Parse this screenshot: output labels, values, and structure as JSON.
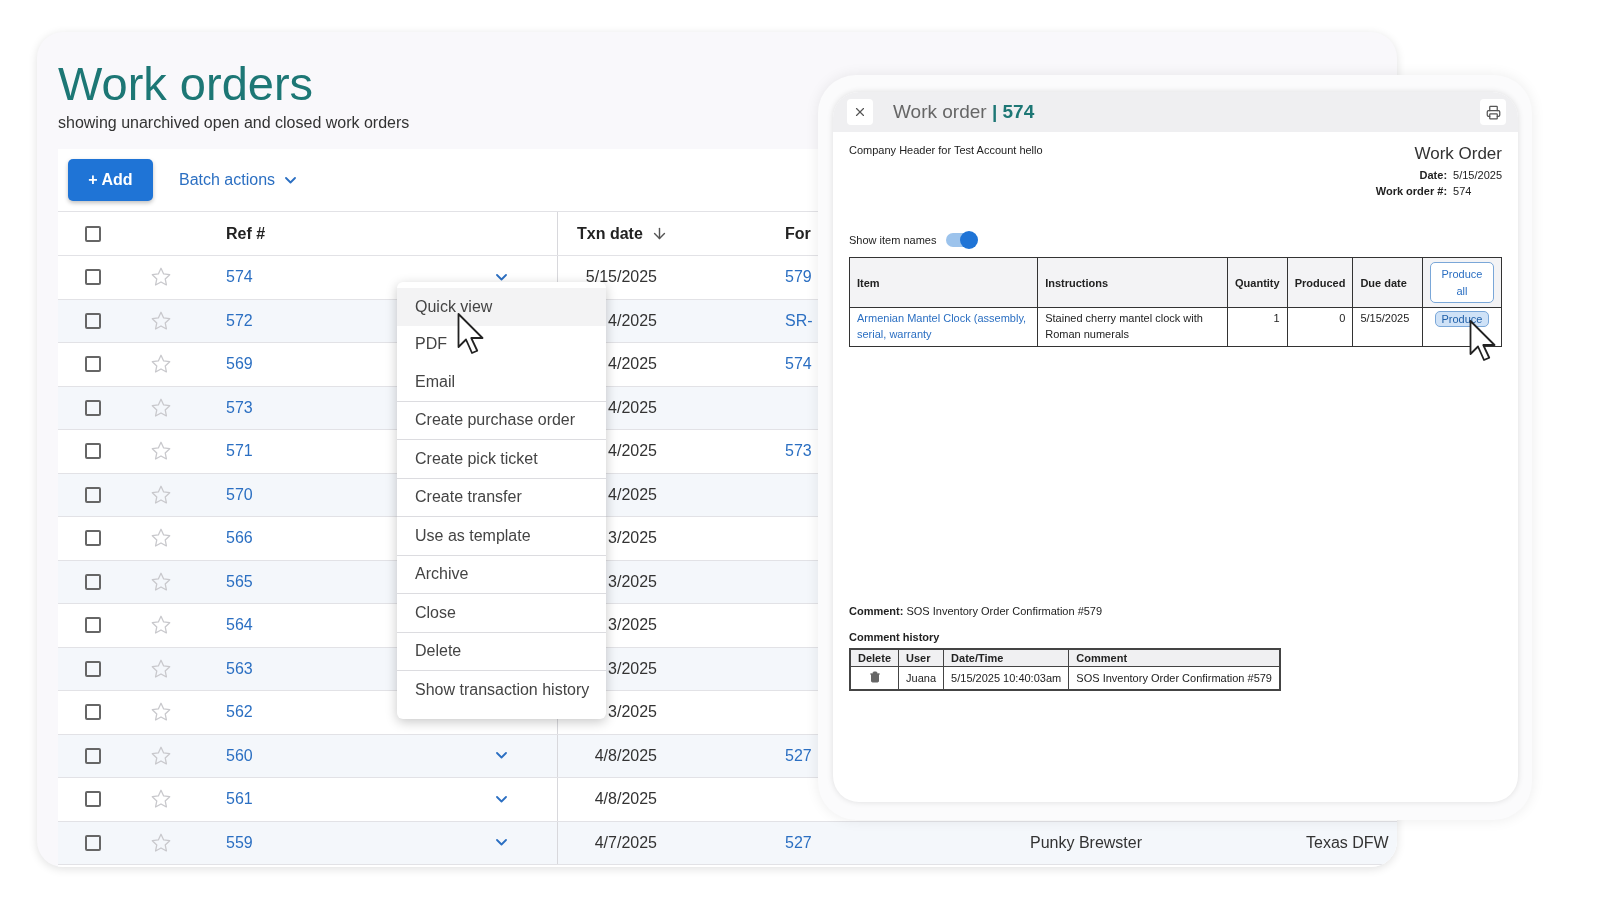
{
  "page": {
    "title": "Work orders",
    "subtitle": "showing unarchived open and closed work orders"
  },
  "toolbar": {
    "add_button": "+ Add",
    "batch_actions": "Batch actions"
  },
  "table": {
    "select_all_checked": false,
    "columns": {
      "ref": "Ref #",
      "txn_date": "Txn date",
      "for": "For"
    },
    "rows": [
      {
        "checked": false,
        "starred": false,
        "ref": "574",
        "caret": true,
        "date": "5/15/2025",
        "for": "579"
      },
      {
        "checked": false,
        "starred": false,
        "ref": "572",
        "caret": false,
        "date": "4/2025",
        "for": "SR-"
      },
      {
        "checked": false,
        "starred": false,
        "ref": "569",
        "caret": false,
        "date": "4/2025",
        "for": "574"
      },
      {
        "checked": false,
        "starred": false,
        "ref": "573",
        "caret": false,
        "date": "4/2025"
      },
      {
        "checked": false,
        "starred": false,
        "ref": "571",
        "caret": false,
        "date": "4/2025",
        "for": "573"
      },
      {
        "checked": false,
        "starred": false,
        "ref": "570",
        "caret": false,
        "date": "4/2025"
      },
      {
        "checked": false,
        "starred": false,
        "ref": "566",
        "caret": false,
        "date": "3/2025"
      },
      {
        "checked": false,
        "starred": false,
        "ref": "565",
        "caret": false,
        "date": "3/2025"
      },
      {
        "checked": false,
        "starred": false,
        "ref": "564",
        "caret": false,
        "date": "3/2025"
      },
      {
        "checked": false,
        "starred": false,
        "ref": "563",
        "caret": false,
        "date": "3/2025"
      },
      {
        "checked": false,
        "starred": false,
        "ref": "562",
        "caret": false,
        "date": "3/2025"
      },
      {
        "checked": false,
        "starred": false,
        "ref": "560",
        "caret": true,
        "date": "4/8/2025",
        "for": "527"
      },
      {
        "checked": false,
        "starred": false,
        "ref": "561",
        "caret": true,
        "date": "4/8/2025"
      },
      {
        "checked": false,
        "starred": false,
        "ref": "559",
        "caret": true,
        "date": "4/7/2025",
        "for": "527",
        "customer": "Punky Brewster",
        "location": "Texas DFW"
      }
    ]
  },
  "context_menu": {
    "groups": [
      [
        {
          "label": "Quick view",
          "selected": true
        },
        {
          "label": "PDF",
          "selected": false
        },
        {
          "label": "Email",
          "selected": false
        }
      ],
      [
        {
          "label": "Create purchase order",
          "selected": false
        }
      ],
      [
        {
          "label": "Create pick ticket",
          "selected": false
        }
      ],
      [
        {
          "label": "Create transfer",
          "selected": false
        }
      ],
      [
        {
          "label": "Use as template",
          "selected": false
        }
      ],
      [
        {
          "label": "Archive",
          "selected": false
        }
      ],
      [
        {
          "label": "Close",
          "selected": false
        }
      ],
      [
        {
          "label": "Delete",
          "selected": false
        }
      ],
      [
        {
          "label": "Show transaction history",
          "selected": false
        }
      ]
    ]
  },
  "quick_view": {
    "title": "Work order",
    "separator": "|",
    "number": "574",
    "company_header": "Company Header for Test Account hello",
    "doc_title": "Work Order",
    "meta": [
      {
        "label": "Date:",
        "value": "5/15/2025"
      },
      {
        "label": "Work order #:",
        "value": "574"
      }
    ],
    "show_item_names": {
      "label": "Show item names",
      "on": true
    },
    "items_table": {
      "columns": [
        "Item",
        "Instructions",
        "Quantity",
        "Produced",
        "Due date"
      ],
      "produce_all": "Produce all",
      "rows": [
        {
          "item": "Armenian Mantel Clock (assembly, serial, warranty",
          "instructions": "Stained cherry mantel clock with Roman numerals",
          "quantity": "1",
          "produced": "0",
          "due_date": "5/15/2025",
          "action": "Produce"
        }
      ]
    },
    "comment": {
      "label": "Comment:",
      "text": "SOS Inventory Order Confirmation #579"
    },
    "comment_history": {
      "title": "Comment history",
      "columns": [
        "Delete",
        "User",
        "Date/Time",
        "Comment"
      ],
      "rows": [
        {
          "user": "Juana",
          "datetime": "5/15/2025 10:40:03am",
          "comment": "SOS Inventory Order Confirmation #579"
        }
      ]
    }
  }
}
